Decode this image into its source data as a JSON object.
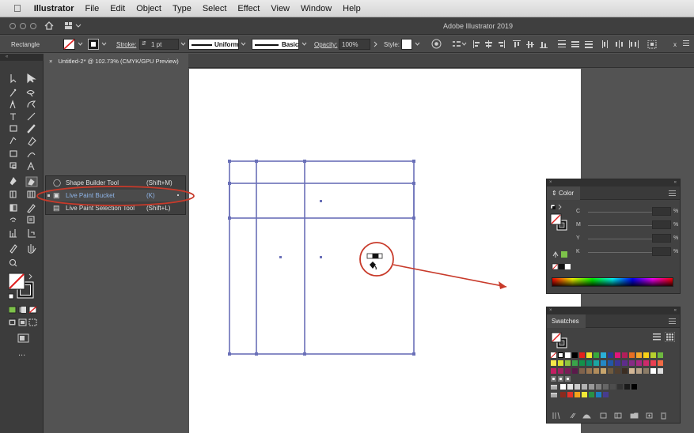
{
  "menubar": {
    "apple": "",
    "items": [
      "Illustrator",
      "File",
      "Edit",
      "Object",
      "Type",
      "Select",
      "Effect",
      "View",
      "Window",
      "Help"
    ]
  },
  "titlebar": {
    "title": "Adobe Illustrator 2019"
  },
  "control_bar": {
    "selection_type": "Rectangle",
    "stroke_label": "Stroke:",
    "stroke_weight": "1 pt",
    "profile": "Uniform",
    "brush": "Basic",
    "opacity_label": "Opacity:",
    "opacity_value": "100%",
    "style_label": "Style:",
    "more_label": "x"
  },
  "document_tab": {
    "title": "Untitled-2* @ 102.73% (CMYK/GPU Preview)",
    "close": "×"
  },
  "toolbar": {
    "more_tools": "..."
  },
  "flyout": {
    "items": [
      {
        "label": "Shape Builder Tool",
        "shortcut": "(Shift+M)"
      },
      {
        "label": "Live Paint Bucket",
        "shortcut": "(K)"
      },
      {
        "label": "Live Paint Selection Tool",
        "shortcut": "(Shift+L)"
      }
    ]
  },
  "color_panel": {
    "close": "×",
    "collapse": "«",
    "tab": "Color",
    "channels": [
      {
        "name": "C",
        "unit": "%"
      },
      {
        "name": "M",
        "unit": "%"
      },
      {
        "name": "Y",
        "unit": "%"
      },
      {
        "name": "K",
        "unit": "%"
      }
    ]
  },
  "swatches_panel": {
    "close": "×",
    "collapse": "«",
    "tab": "Swatches"
  },
  "colors": {
    "annotation_red": "#c83a2a",
    "selection_blue": "#6a70b8",
    "highlight_text": "#8fb5e8",
    "panel_bg": "#424242"
  }
}
